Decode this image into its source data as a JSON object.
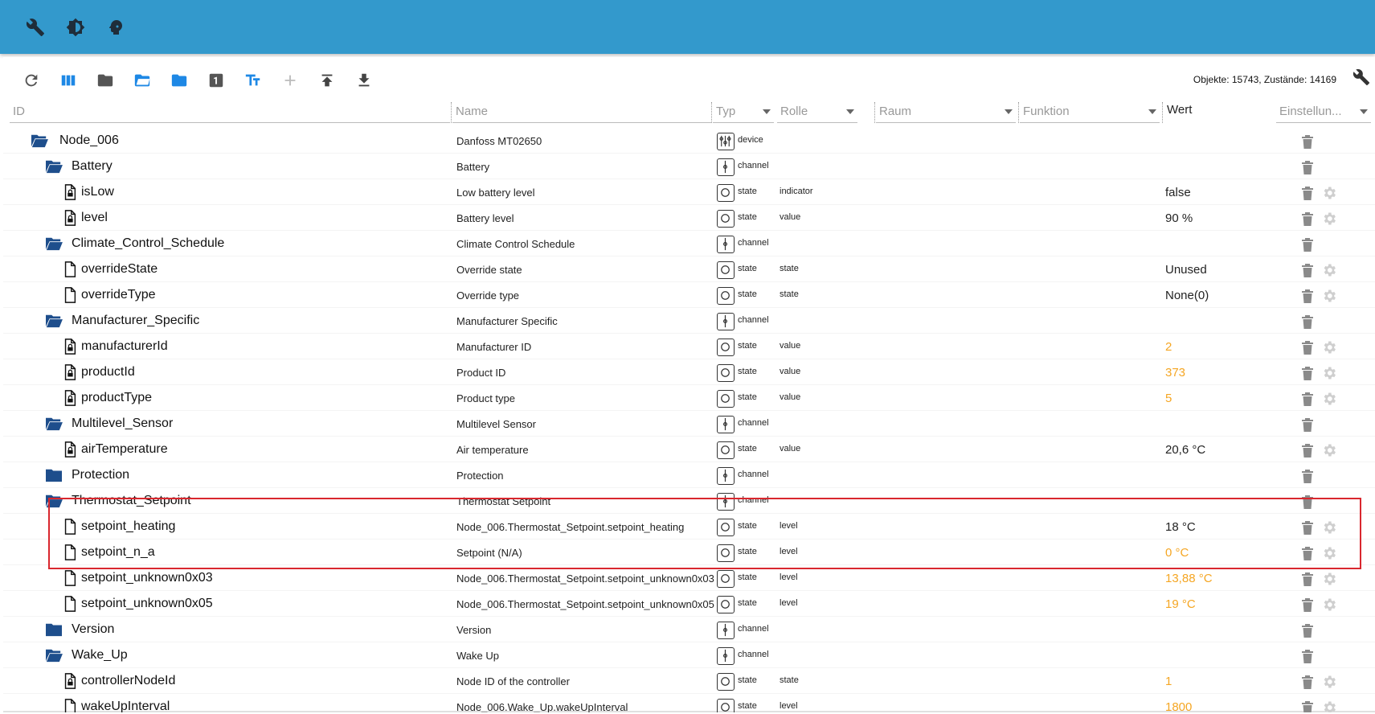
{
  "topbar": {
    "icons": [
      "wrench-icon",
      "brightness-icon",
      "head-profile-icon"
    ]
  },
  "toolbar": {
    "buttons": [
      "refresh-icon",
      "columns-icon",
      "folder-icon",
      "folder-open-icon",
      "folder-closed-icon",
      "number-one-icon",
      "font-size-icon",
      "add-icon",
      "upload-icon",
      "download-icon"
    ],
    "counts": "Objekte: 15743, Zustände: 14169"
  },
  "columns": {
    "id": "ID",
    "name": "Name",
    "type": "Typ",
    "role": "Rolle",
    "room": "Raum",
    "function": "Funktion",
    "value": "Wert",
    "settings": "Einstellun..."
  },
  "colors": {
    "header": "#3399cc",
    "orange": "#f5a623",
    "highlight": "#d9272e"
  },
  "rows": [
    {
      "id": "Node_006",
      "level": 0,
      "kind": "folder-open",
      "name": "Danfoss MT02650",
      "type": "device",
      "role": "",
      "value": "",
      "orange": false,
      "gear": false
    },
    {
      "id": "Battery",
      "level": 1,
      "kind": "folder-open",
      "name": "Battery",
      "type": "channel",
      "role": "",
      "value": "",
      "orange": false,
      "gear": false
    },
    {
      "id": "isLow",
      "level": 2,
      "kind": "file-lock",
      "name": "Low battery level",
      "type": "state",
      "role": "indicator",
      "value": "false",
      "orange": false,
      "gear": true
    },
    {
      "id": "level",
      "level": 2,
      "kind": "file-lock",
      "name": "Battery level",
      "type": "state",
      "role": "value",
      "value": "90 %",
      "orange": false,
      "gear": true
    },
    {
      "id": "Climate_Control_Schedule",
      "level": 1,
      "kind": "folder-open",
      "name": "Climate Control Schedule",
      "type": "channel",
      "role": "",
      "value": "",
      "orange": false,
      "gear": false
    },
    {
      "id": "overrideState",
      "level": 2,
      "kind": "file",
      "name": "Override state",
      "type": "state",
      "role": "state",
      "value": "Unused",
      "orange": false,
      "gear": true
    },
    {
      "id": "overrideType",
      "level": 2,
      "kind": "file",
      "name": "Override type",
      "type": "state",
      "role": "state",
      "value": "None(0)",
      "orange": false,
      "gear": true
    },
    {
      "id": "Manufacturer_Specific",
      "level": 1,
      "kind": "folder-open",
      "name": "Manufacturer Specific",
      "type": "channel",
      "role": "",
      "value": "",
      "orange": false,
      "gear": false
    },
    {
      "id": "manufacturerId",
      "level": 2,
      "kind": "file-lock",
      "name": "Manufacturer ID",
      "type": "state",
      "role": "value",
      "value": "2",
      "orange": true,
      "gear": true
    },
    {
      "id": "productId",
      "level": 2,
      "kind": "file-lock",
      "name": "Product ID",
      "type": "state",
      "role": "value",
      "value": "373",
      "orange": true,
      "gear": true
    },
    {
      "id": "productType",
      "level": 2,
      "kind": "file-lock",
      "name": "Product type",
      "type": "state",
      "role": "value",
      "value": "5",
      "orange": true,
      "gear": true
    },
    {
      "id": "Multilevel_Sensor",
      "level": 1,
      "kind": "folder-open",
      "name": "Multilevel Sensor",
      "type": "channel",
      "role": "",
      "value": "",
      "orange": false,
      "gear": false
    },
    {
      "id": "airTemperature",
      "level": 2,
      "kind": "file-lock",
      "name": "Air temperature",
      "type": "state",
      "role": "value",
      "value": "20,6 °C",
      "orange": false,
      "gear": true
    },
    {
      "id": "Protection",
      "level": 1,
      "kind": "folder",
      "name": "Protection",
      "type": "channel",
      "role": "",
      "value": "",
      "orange": false,
      "gear": false
    },
    {
      "id": "Thermostat_Setpoint",
      "level": 1,
      "kind": "folder-open",
      "name": "Thermostat Setpoint",
      "type": "channel",
      "role": "",
      "value": "",
      "orange": false,
      "gear": false
    },
    {
      "id": "setpoint_heating",
      "level": 2,
      "kind": "file",
      "name": "Node_006.Thermostat_Setpoint.setpoint_heating",
      "type": "state",
      "role": "level",
      "value": "18 °C",
      "orange": false,
      "gear": true
    },
    {
      "id": "setpoint_n_a",
      "level": 2,
      "kind": "file",
      "name": "Setpoint (N/A)",
      "type": "state",
      "role": "level",
      "value": "0 °C",
      "orange": true,
      "gear": true
    },
    {
      "id": "setpoint_unknown0x03",
      "level": 2,
      "kind": "file",
      "name": "Node_006.Thermostat_Setpoint.setpoint_unknown0x03",
      "type": "state",
      "role": "level",
      "value": "13,88 °C",
      "orange": true,
      "gear": true
    },
    {
      "id": "setpoint_unknown0x05",
      "level": 2,
      "kind": "file",
      "name": "Node_006.Thermostat_Setpoint.setpoint_unknown0x05",
      "type": "state",
      "role": "level",
      "value": "19 °C",
      "orange": true,
      "gear": true
    },
    {
      "id": "Version",
      "level": 1,
      "kind": "folder",
      "name": "Version",
      "type": "channel",
      "role": "",
      "value": "",
      "orange": false,
      "gear": false
    },
    {
      "id": "Wake_Up",
      "level": 1,
      "kind": "folder-open",
      "name": "Wake Up",
      "type": "channel",
      "role": "",
      "value": "",
      "orange": false,
      "gear": false
    },
    {
      "id": "controllerNodeId",
      "level": 2,
      "kind": "file-lock",
      "name": "Node ID of the controller",
      "type": "state",
      "role": "state",
      "value": "1",
      "orange": true,
      "gear": true
    },
    {
      "id": "wakeUpInterval",
      "level": 2,
      "kind": "file",
      "name": "Node_006.Wake_Up.wakeUpInterval",
      "type": "state",
      "role": "level",
      "value": "1800",
      "orange": true,
      "gear": true
    }
  ]
}
